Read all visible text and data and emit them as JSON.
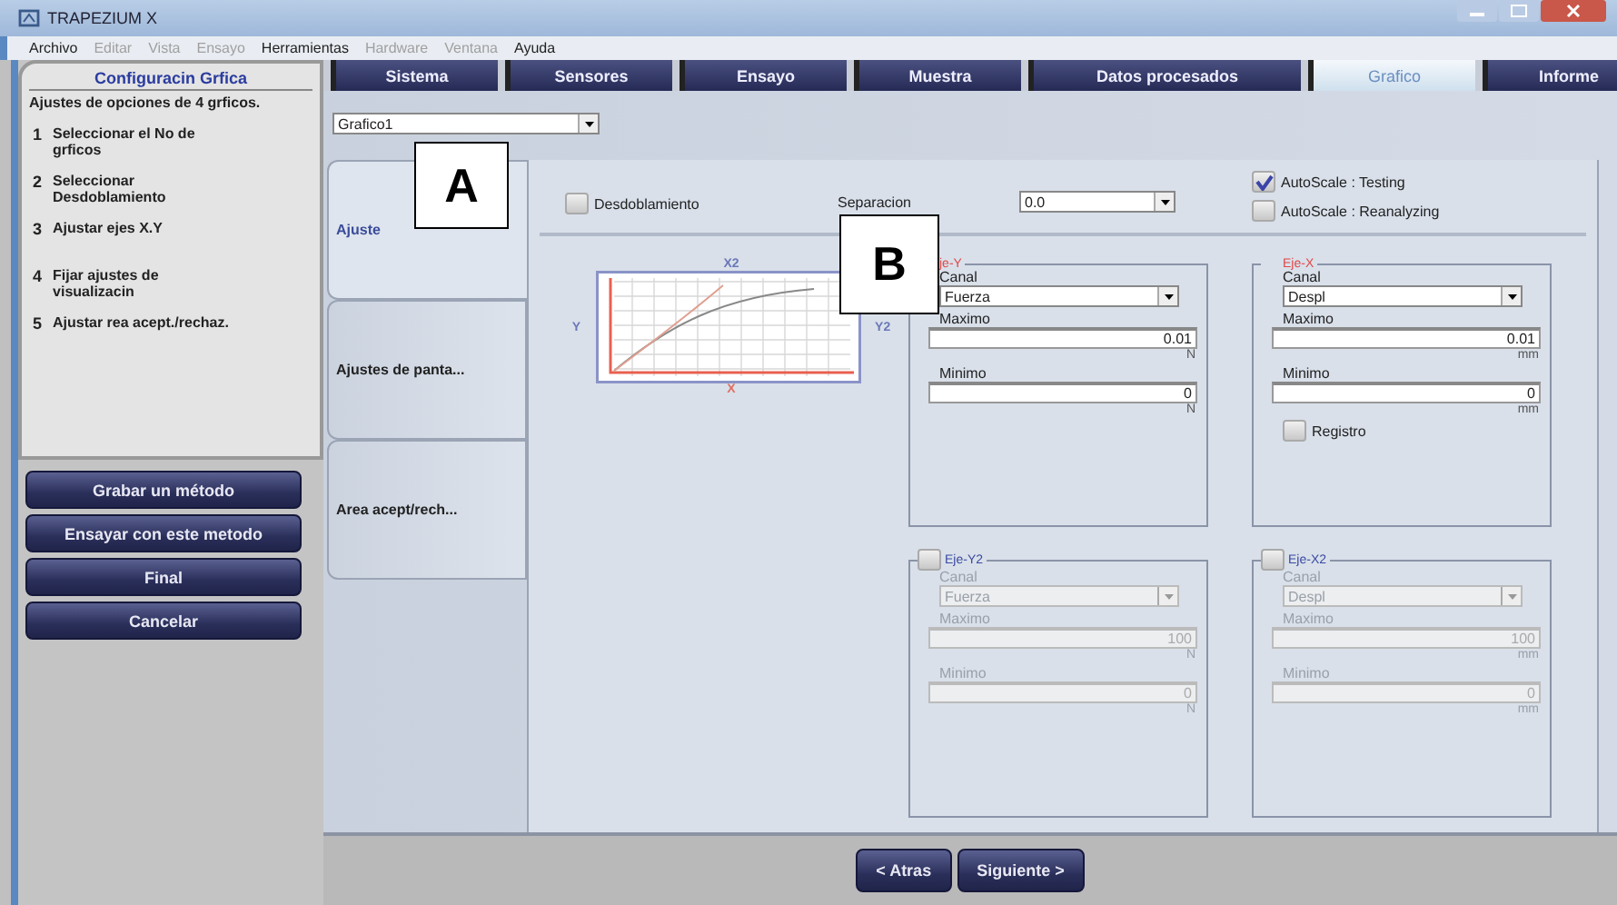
{
  "window": {
    "title": "TRAPEZIUM X"
  },
  "menu": [
    {
      "label": "Archivo",
      "disabled": false
    },
    {
      "label": "Editar",
      "disabled": true
    },
    {
      "label": "Vista",
      "disabled": true
    },
    {
      "label": "Ensayo",
      "disabled": true
    },
    {
      "label": "Herramientas",
      "disabled": false
    },
    {
      "label": "Hardware",
      "disabled": true
    },
    {
      "label": "Ventana",
      "disabled": true
    },
    {
      "label": "Ayuda",
      "disabled": false
    }
  ],
  "wizard": {
    "title": "Configuracin Grfica",
    "description": "Ajustes de opciones de 4 grficos.",
    "steps": [
      {
        "number": "1",
        "label": "Seleccionar el No de grficos"
      },
      {
        "number": "2",
        "label": "Seleccionar Desdoblamiento"
      },
      {
        "number": "3",
        "label": "Ajustar ejes X.Y"
      },
      {
        "number": "4",
        "label": "Fijar ajustes de visualizacin"
      },
      {
        "number": "5",
        "label": "Ajustar rea acept./rechaz."
      }
    ]
  },
  "actions": [
    "Grabar un método",
    "Ensayar con este metodo",
    "Final",
    "Cancelar"
  ],
  "tabs": [
    {
      "label": "Sistema",
      "selected": false
    },
    {
      "label": "Sensores",
      "selected": false
    },
    {
      "label": "Ensayo",
      "selected": false
    },
    {
      "label": "Muestra",
      "selected": false
    },
    {
      "label": "Datos procesados",
      "selected": false
    },
    {
      "label": "Grafico",
      "selected": true
    },
    {
      "label": "Informe",
      "selected": false
    }
  ],
  "graph_select": {
    "value": "Grafico1"
  },
  "side_tabs": [
    {
      "label": "Ajuste",
      "selected": true
    },
    {
      "label": "Ajustes de panta...",
      "selected": false
    },
    {
      "label": "Area acept/rech...",
      "selected": false
    }
  ],
  "options": {
    "unfold": {
      "label": "Desdoblamiento",
      "checked": false
    },
    "separation": {
      "label": "Separacion",
      "value": "0.0"
    },
    "autoscale": [
      {
        "label": "AutoScale : Testing",
        "checked": true
      },
      {
        "label": "AutoScale : Reanalyzing",
        "checked": false
      }
    ]
  },
  "preview": {
    "top": "X2",
    "left": "Y",
    "right": "Y2",
    "bottom": "X"
  },
  "axes": [
    {
      "kind": "fixed",
      "title": "je-Y",
      "channel_label": "Canal",
      "channel": "Fuerza",
      "max_label": "Maximo",
      "max": "0.01",
      "max_unit": "N",
      "min_label": "Minimo",
      "min": "0",
      "min_unit": "N"
    },
    {
      "kind": "fixed",
      "title": "Eje-X",
      "channel_label": "Canal",
      "channel": "Despl",
      "max_label": "Maximo",
      "max": "0.01",
      "max_unit": "mm",
      "min_label": "Minimo",
      "min": "0",
      "min_unit": "mm",
      "log": {
        "label": "Registro",
        "checked": false
      }
    },
    {
      "kind": "optional",
      "title": "Eje-Y2",
      "checked": false,
      "disabled": true,
      "channel_label": "Canal",
      "channel": "Fuerza",
      "max_label": "Maximo",
      "max": "100",
      "max_unit": "N",
      "min_label": "Minimo",
      "min": "0",
      "min_unit": "N"
    },
    {
      "kind": "optional",
      "title": "Eje-X2",
      "checked": false,
      "disabled": true,
      "channel_label": "Canal",
      "channel": "Despl",
      "max_label": "Maximo",
      "max": "100",
      "max_unit": "mm",
      "min_label": "Minimo",
      "min": "0",
      "min_unit": "mm"
    }
  ],
  "nav_buttons": [
    "< Atras",
    "Siguiente >"
  ],
  "annotations": [
    {
      "label": "A"
    },
    {
      "label": "B"
    }
  ]
}
